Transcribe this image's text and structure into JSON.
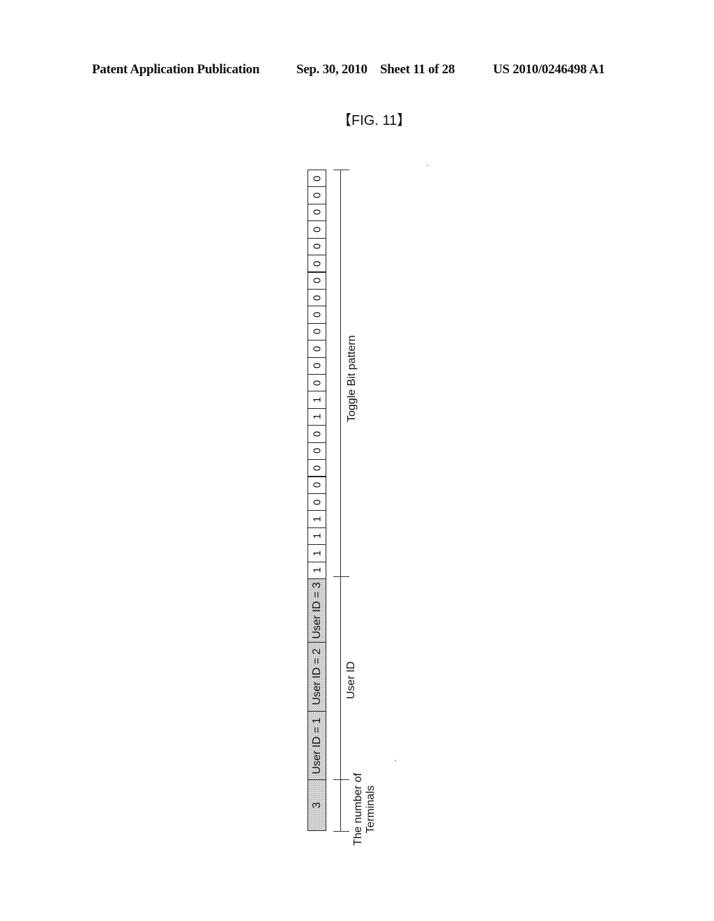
{
  "header": {
    "publication_type": "Patent Application Publication",
    "date": "Sep. 30, 2010",
    "sheet": "Sheet 11 of 28",
    "publication_number": "US 2010/0246498 A1"
  },
  "figure": {
    "label": "【FIG. 11】",
    "fields": {
      "number_of_terminals": {
        "value": "3",
        "label_line1": "The number of",
        "label_line2": "Terminals"
      },
      "user_ids": {
        "label": "User ID",
        "values": [
          "User ID = 1",
          "User ID = 2",
          "User ID = 3"
        ]
      },
      "toggle_bit_pattern": {
        "label": "Toggle Bit pattern",
        "bits": [
          "1",
          "1",
          "1",
          "1",
          "0",
          "0",
          "0",
          "0",
          "0",
          "1",
          "1",
          "0",
          "0",
          "0",
          "0",
          "0",
          "0",
          "0",
          "0",
          "0",
          "0",
          "0",
          "0",
          "0"
        ]
      }
    }
  }
}
